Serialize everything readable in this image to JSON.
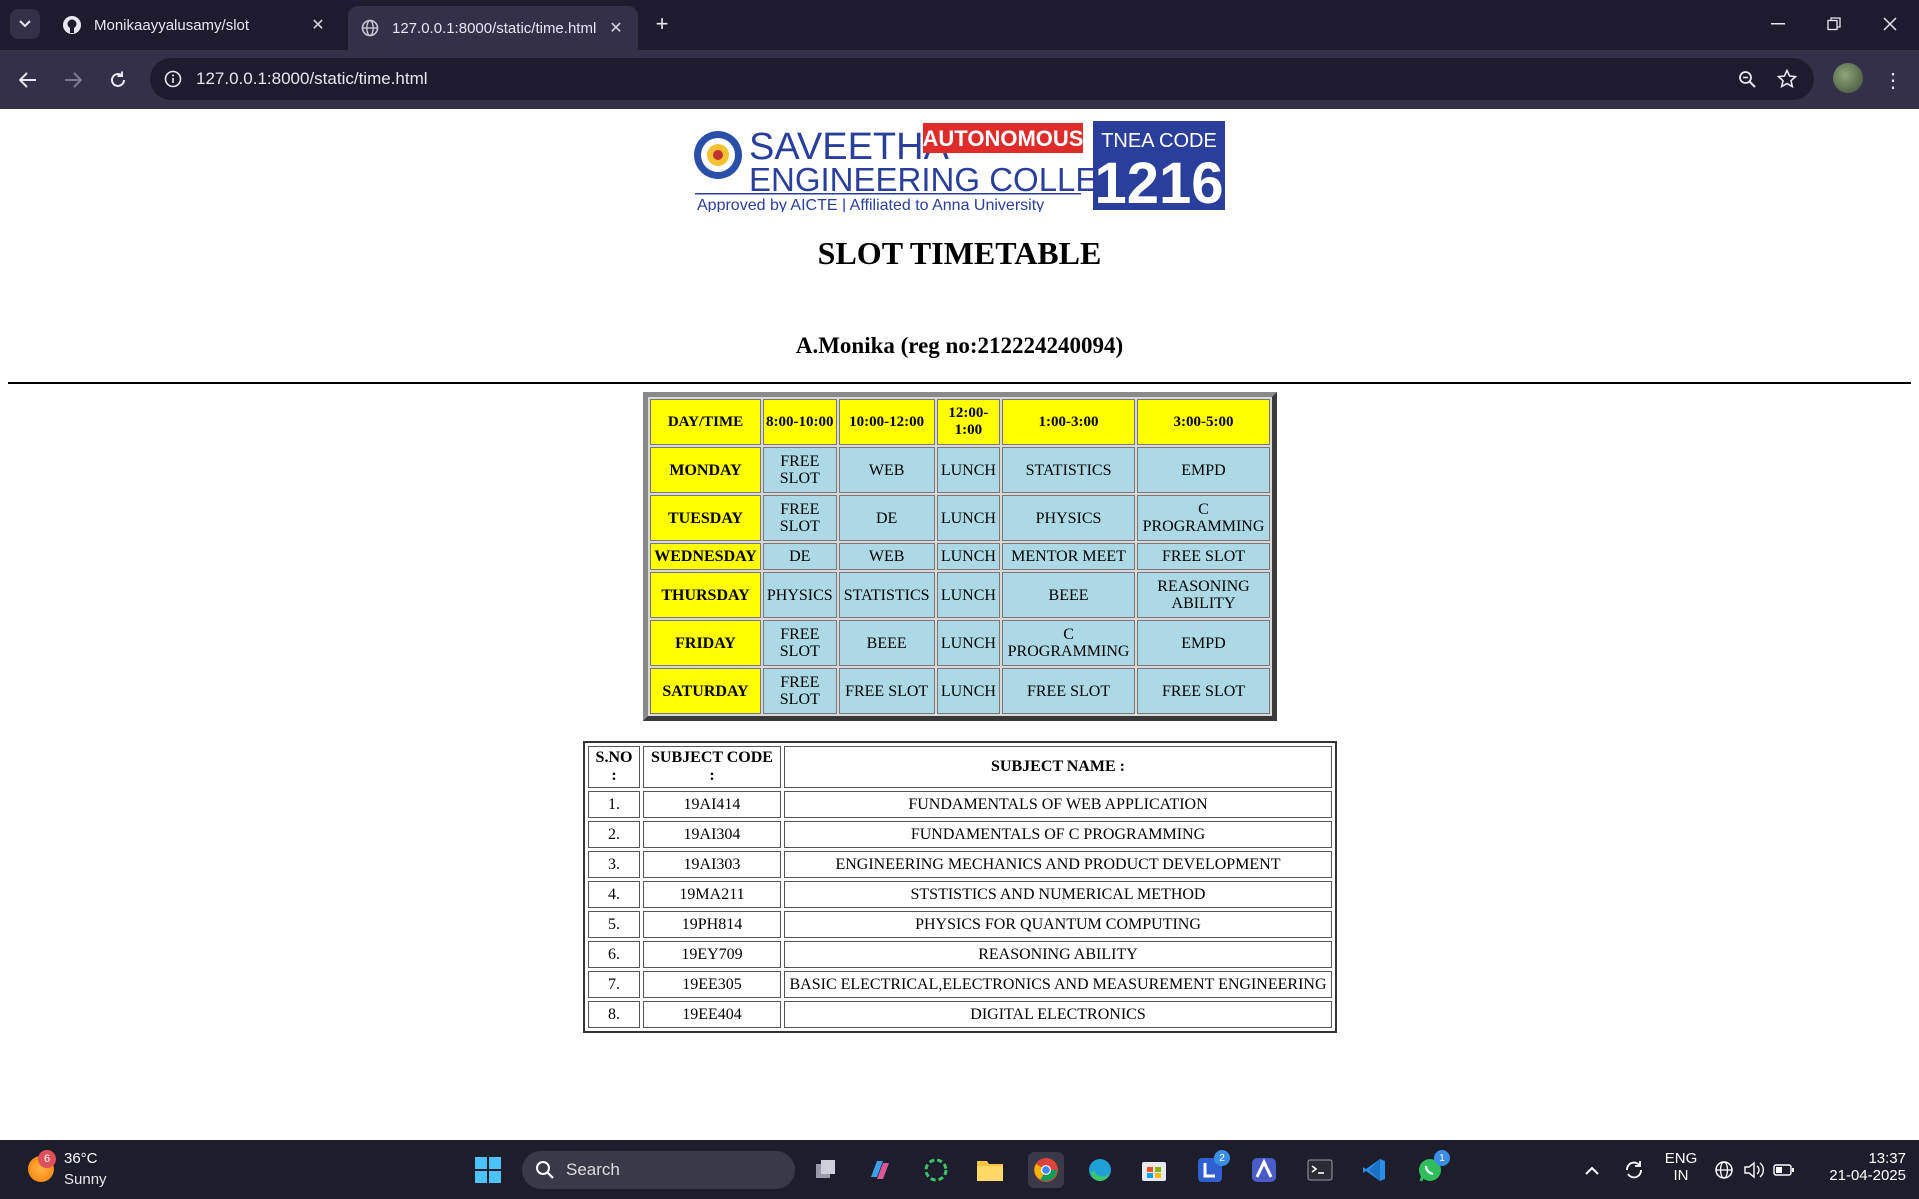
{
  "browser": {
    "tabs": [
      {
        "title": "Monikaayyalusamy/slot",
        "icon": "github-icon",
        "active": false
      },
      {
        "title": "127.0.0.1:8000/static/time.html",
        "icon": "globe-icon",
        "active": true
      }
    ],
    "address": "127.0.0.1:8000/static/time.html"
  },
  "page": {
    "logo": {
      "line1": "SAVEETHA",
      "badge": "AUTONOMOUS",
      "line2": "ENGINEERING COLLEGE",
      "tagline": "Approved by AICTE | Affiliated to Anna University",
      "tnea_label": "TNEA CODE",
      "tnea_code": "1216"
    },
    "title": "SLOT TIMETABLE",
    "student": "A.Monika (reg no:212224240094)",
    "timetable": {
      "headers": [
        "DAY/TIME",
        "8:00-10:00",
        "10:00-12:00",
        "12:00-1:00",
        "1:00-3:00",
        "3:00-5:00"
      ],
      "rows": [
        {
          "day": "MONDAY",
          "slots": [
            "FREE SLOT",
            "WEB",
            "LUNCH",
            "STATISTICS",
            "EMPD"
          ]
        },
        {
          "day": "TUESDAY",
          "slots": [
            "FREE SLOT",
            "DE",
            "LUNCH",
            "PHYSICS",
            "C PROGRAMMING"
          ]
        },
        {
          "day": "WEDNESDAY",
          "slots": [
            "DE",
            "WEB",
            "LUNCH",
            "MENTOR MEET",
            "FREE SLOT"
          ]
        },
        {
          "day": "THURSDAY",
          "slots": [
            "PHYSICS",
            "STATISTICS",
            "LUNCH",
            "BEEE",
            "REASONING ABILITY"
          ]
        },
        {
          "day": "FRIDAY",
          "slots": [
            "FREE SLOT",
            "BEEE",
            "LUNCH",
            "C PROGRAMMING",
            "EMPD"
          ]
        },
        {
          "day": "SATURDAY",
          "slots": [
            "FREE SLOT",
            "FREE SLOT",
            "LUNCH",
            "FREE SLOT",
            "FREE SLOT"
          ]
        }
      ]
    },
    "subjects": {
      "headers": [
        "S.NO :",
        "SUBJECT CODE :",
        "SUBJECT NAME :"
      ],
      "rows": [
        [
          "1.",
          "19AI414",
          "FUNDAMENTALS OF WEB APPLICATION"
        ],
        [
          "2.",
          "19AI304",
          "FUNDAMENTALS OF C PROGRAMMING"
        ],
        [
          "3.",
          "19AI303",
          "ENGINEERING MECHANICS AND PRODUCT DEVELOPMENT"
        ],
        [
          "4.",
          "19MA211",
          "STSTISTICS AND NUMERICAL METHOD"
        ],
        [
          "5.",
          "19PH814",
          "PHYSICS FOR QUANTUM COMPUTING"
        ],
        [
          "6.",
          "19EY709",
          "REASONING ABILITY"
        ],
        [
          "7.",
          "19EE305",
          "BASIC ELECTRICAL,ELECTRONICS AND MEASUREMENT ENGINEERING"
        ],
        [
          "8.",
          "19EE404",
          "DIGITAL ELECTRONICS"
        ]
      ]
    }
  },
  "taskbar": {
    "weather": {
      "badge": "6",
      "temp": "36°C",
      "desc": "Sunny"
    },
    "search_placeholder": "Search",
    "badges": {
      "l_app": "2",
      "whatsapp": "1"
    },
    "language": {
      "line1": "ENG",
      "line2": "IN"
    },
    "clock": {
      "time": "13:37",
      "date": "21-04-2025"
    }
  },
  "colors": {
    "header_yellow": "#ffff00",
    "cell_blue": "#add8e6",
    "chrome_dark": "#1f1b2e",
    "chrome_mid": "#35304a",
    "taskbar": "#1e1d2b"
  }
}
